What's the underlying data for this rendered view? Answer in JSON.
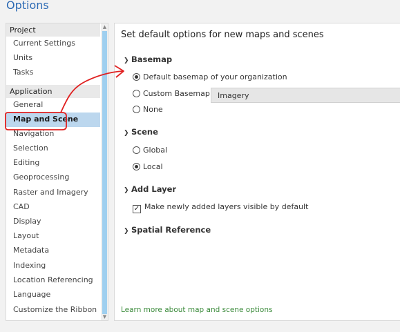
{
  "window": {
    "title": "Options"
  },
  "nav": {
    "groups": [
      {
        "header": "Project",
        "items": [
          "Current Settings",
          "Units",
          "Tasks"
        ]
      },
      {
        "header": "Application",
        "items": [
          "General",
          "Map and Scene",
          "Navigation",
          "Selection",
          "Editing",
          "Geoprocessing",
          "Raster and Imagery",
          "CAD",
          "Display",
          "Layout",
          "Metadata",
          "Indexing",
          "Location Referencing",
          "Language",
          "Customize the Ribbon"
        ]
      }
    ],
    "selected_item": "Map and Scene"
  },
  "content": {
    "title": "Set default options for new maps and scenes",
    "basemap": {
      "header": "Basemap",
      "options": [
        {
          "label": "Default basemap of your organization",
          "selected": true
        },
        {
          "label": "Custom Basemap",
          "selected": false
        },
        {
          "label": "None",
          "selected": false
        }
      ],
      "custom_value": "Imagery"
    },
    "scene": {
      "header": "Scene",
      "options": [
        {
          "label": "Global",
          "selected": false
        },
        {
          "label": "Local",
          "selected": true
        }
      ]
    },
    "add_layer": {
      "header": "Add Layer",
      "checkbox_label": "Make newly added layers visible by default",
      "checked": true
    },
    "spatial_reference": {
      "header": "Spatial Reference"
    },
    "learn_more": "Learn more about map and scene options"
  },
  "icons": {
    "expanded": "chevron-down-icon",
    "collapsed": "chevron-right-icon",
    "check": "check-icon"
  },
  "colors": {
    "title": "#2c6ab4",
    "selection": "#bcd7ee",
    "scroll_thumb": "#9fcfef",
    "link": "#3d8c3d",
    "annotation": "#e02020"
  }
}
